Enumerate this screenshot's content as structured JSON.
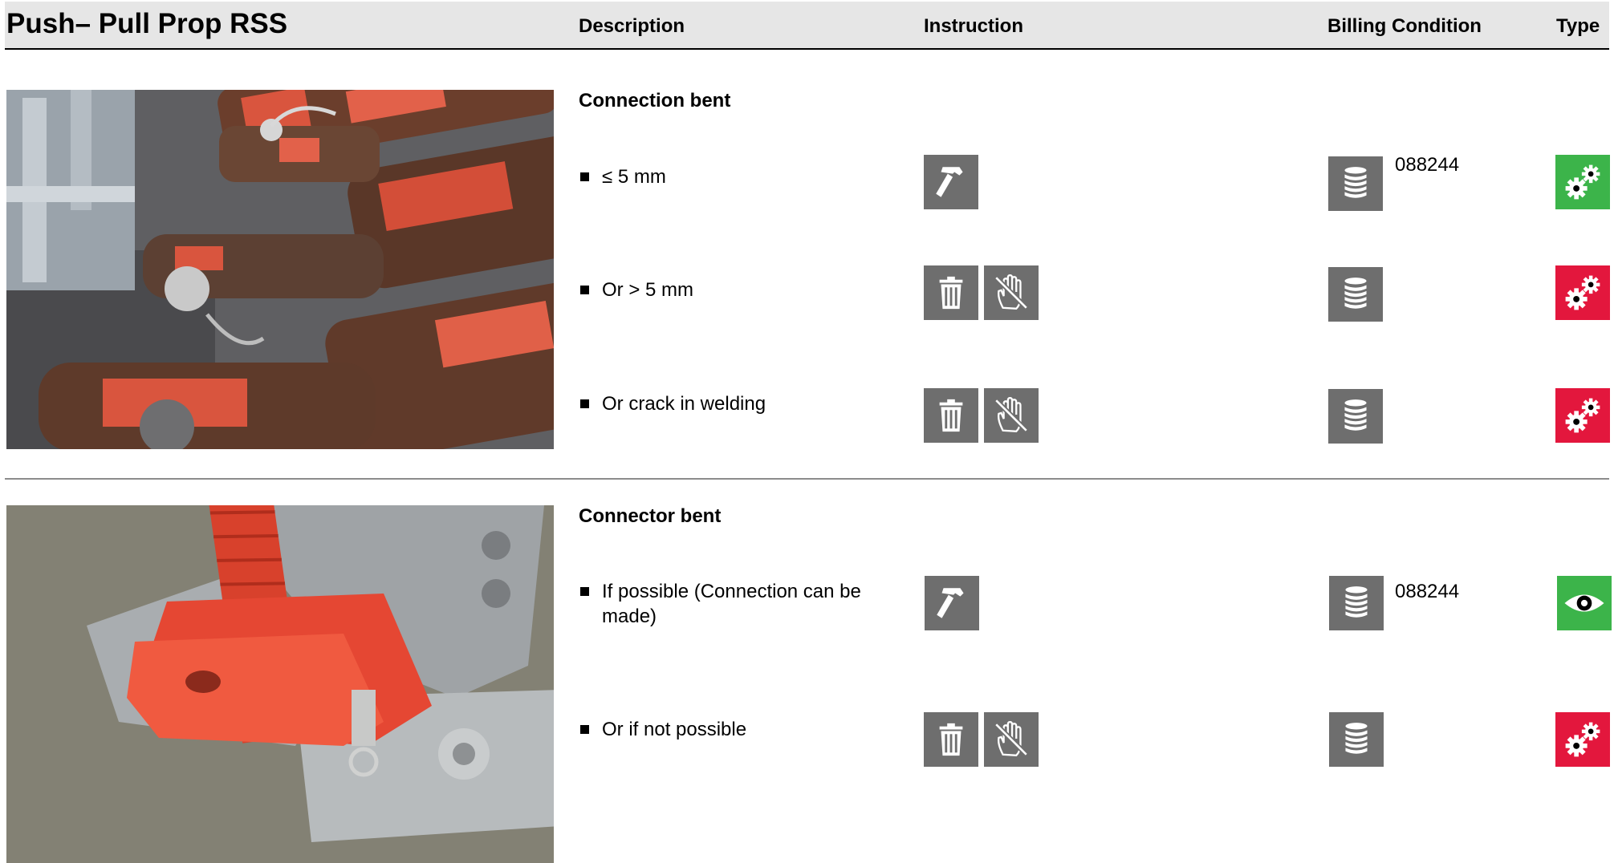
{
  "header": {
    "title": "Push– Pull Prop RSS",
    "col_description": "Description",
    "col_instruction": "Instruction",
    "col_billing": "Billing Condition",
    "col_type": "Type"
  },
  "sections": [
    {
      "title": "Connection bent",
      "photo": "photo of rusty red push-pull prop connection heads",
      "items": [
        {
          "text": "≤ 5 mm",
          "instruction_icons": [
            "hammer-icon"
          ],
          "billing_icon": "coin-stack-icon",
          "billing_code": "088244",
          "type_icon": "gears-icon",
          "type_color": "#3cb44a"
        },
        {
          "text": "Or > 5 mm",
          "instruction_icons": [
            "trash-icon",
            "no-touch-icon"
          ],
          "billing_icon": "coin-stack-icon",
          "billing_code": "",
          "type_icon": "gears-icon",
          "type_color": "#e3173d"
        },
        {
          "text": "Or crack in welding",
          "instruction_icons": [
            "trash-icon",
            "no-touch-icon"
          ],
          "billing_icon": "coin-stack-icon",
          "billing_code": "",
          "type_icon": "gears-icon",
          "type_color": "#e3173d"
        }
      ]
    },
    {
      "title": "Connector bent",
      "photo": "photo of red connector plate with spindle on galvanized base",
      "items": [
        {
          "text": "If possible (Connection can be made)",
          "instruction_icons": [
            "hammer-icon"
          ],
          "billing_icon": "coin-stack-icon",
          "billing_code": "088244",
          "type_icon": "eye-icon",
          "type_color": "#3cb44a"
        },
        {
          "text": "Or if not possible",
          "instruction_icons": [
            "trash-icon",
            "no-touch-icon"
          ],
          "billing_icon": "coin-stack-icon",
          "billing_code": "",
          "type_icon": "gears-icon",
          "type_color": "#e3173d"
        }
      ]
    }
  ]
}
